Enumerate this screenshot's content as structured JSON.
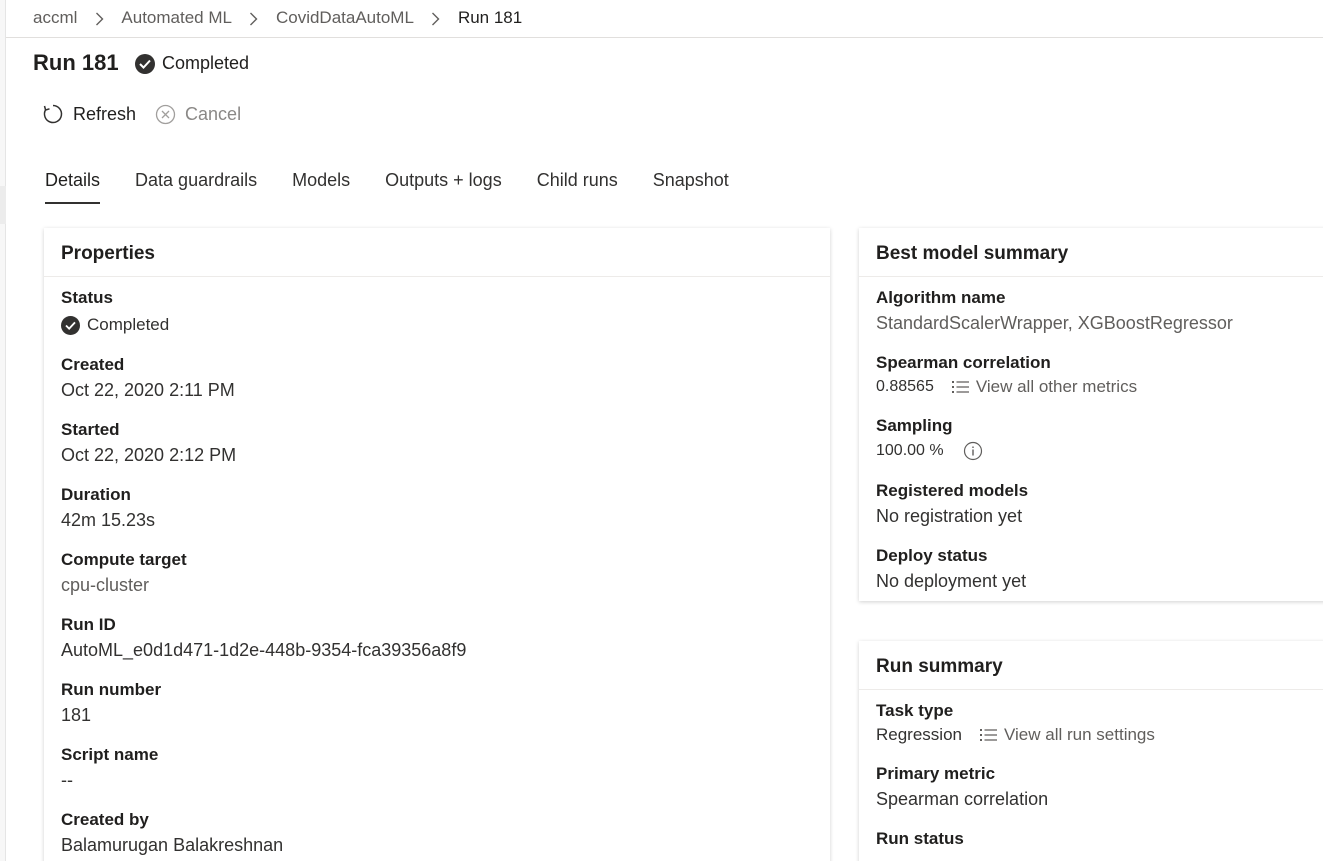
{
  "breadcrumb": {
    "items": [
      "accml",
      "Automated ML",
      "CovidDataAutoML",
      "Run 181"
    ]
  },
  "header": {
    "title": "Run 181",
    "status": "Completed"
  },
  "toolbar": {
    "refresh_label": "Refresh",
    "cancel_label": "Cancel"
  },
  "tabs": [
    {
      "label": "Details",
      "active": true
    },
    {
      "label": "Data guardrails",
      "active": false
    },
    {
      "label": "Models",
      "active": false
    },
    {
      "label": "Outputs + logs",
      "active": false
    },
    {
      "label": "Child runs",
      "active": false
    },
    {
      "label": "Snapshot",
      "active": false
    }
  ],
  "properties": {
    "title": "Properties",
    "status_label": "Status",
    "status_value": "Completed",
    "created_label": "Created",
    "created_value": "Oct 22, 2020 2:11 PM",
    "started_label": "Started",
    "started_value": "Oct 22, 2020 2:12 PM",
    "duration_label": "Duration",
    "duration_value": "42m 15.23s",
    "compute_label": "Compute target",
    "compute_value": "cpu-cluster",
    "runid_label": "Run ID",
    "runid_value": "AutoML_e0d1d471-1d2e-448b-9354-fca39356a8f9",
    "runnumber_label": "Run number",
    "runnumber_value": "181",
    "script_label": "Script name",
    "script_value": "--",
    "createdby_label": "Created by",
    "createdby_value": "Balamurugan Balakreshnan"
  },
  "best_model": {
    "title": "Best model summary",
    "algorithm_label": "Algorithm name",
    "algorithm_value": "StandardScalerWrapper, XGBoostRegressor",
    "spearman_label": "Spearman correlation",
    "spearman_value": "0.88565",
    "metrics_link": "View all other metrics",
    "sampling_label": "Sampling",
    "sampling_value": "100.00 %",
    "registered_label": "Registered models",
    "registered_value": "No registration yet",
    "deploy_label": "Deploy status",
    "deploy_value": "No deployment yet"
  },
  "run_summary": {
    "title": "Run summary",
    "task_label": "Task type",
    "task_value": "Regression",
    "settings_link": "View all run settings",
    "primary_label": "Primary metric",
    "primary_value": "Spearman correlation",
    "runstatus_label": "Run status"
  },
  "icons": {
    "chevron": "chevron-right-icon",
    "status": "checkmark-circle-icon",
    "refresh": "refresh-icon",
    "cancel": "cancel-icon",
    "list": "bulleted-list-icon",
    "info": "info-icon"
  }
}
